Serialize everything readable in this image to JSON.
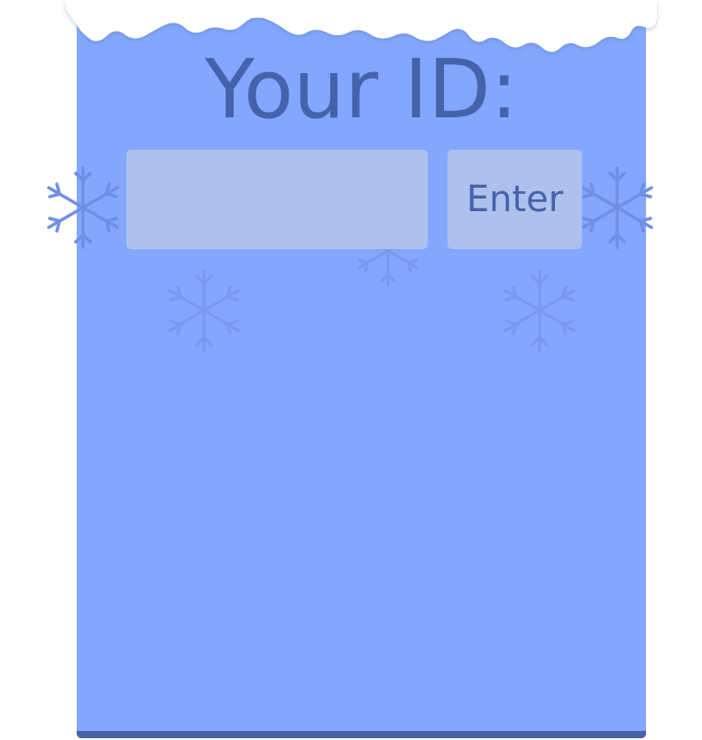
{
  "login": {
    "title": "Your ID:",
    "id_input_value": "",
    "id_input_placeholder": "",
    "enter_label": "Enter"
  },
  "theme": {
    "panel": "#83a7ff",
    "panel_base": "#4a62a8",
    "text": "#4563ab",
    "field": "#aec1ec",
    "snow": "#ffffff",
    "flake_dark": "#6f8fe6",
    "flake_faint": "#7a98ee"
  },
  "icons": [
    "snow-cap-icon",
    "snowflake-icon"
  ]
}
